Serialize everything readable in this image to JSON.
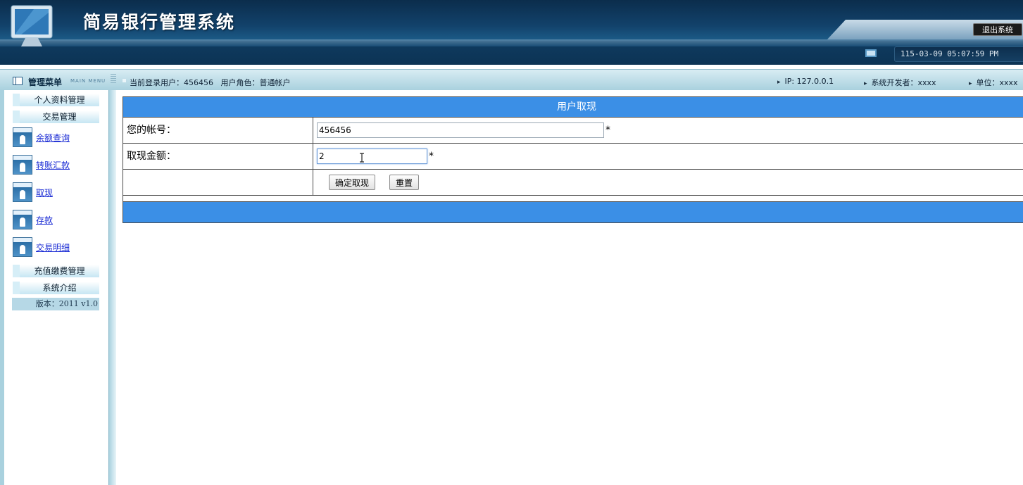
{
  "header": {
    "app_title": "简易银行管理系统",
    "logout_label": "退出系统",
    "datetime": "115-03-09 05:07:59 PM"
  },
  "infobar": {
    "menu_title": "管理菜单",
    "main_menu_label": "MAIN MENU",
    "current_user": "当前登录用户：456456   用户角色：普通帐户",
    "ip": "IP: 127.0.0.1",
    "developer": "系统开发者：xxxx",
    "unit": "单位：xxxx"
  },
  "sidebar": {
    "groups": [
      {
        "label": "个人资料管理"
      },
      {
        "label": "交易管理"
      },
      {
        "label": "充值缴费管理"
      },
      {
        "label": "系统介绍"
      }
    ],
    "links": [
      {
        "label": "余额查询"
      },
      {
        "label": "转账汇款"
      },
      {
        "label": "取现"
      },
      {
        "label": "存款"
      },
      {
        "label": "交易明细"
      }
    ],
    "version": "版本：2011 v1.0"
  },
  "form": {
    "title": "用户取现",
    "account_label": "您的帐号：",
    "account_value": "456456",
    "amount_label": "取现金额：",
    "amount_value": "2",
    "required_mark": "*",
    "submit_label": "确定取现",
    "reset_label": "重置"
  }
}
